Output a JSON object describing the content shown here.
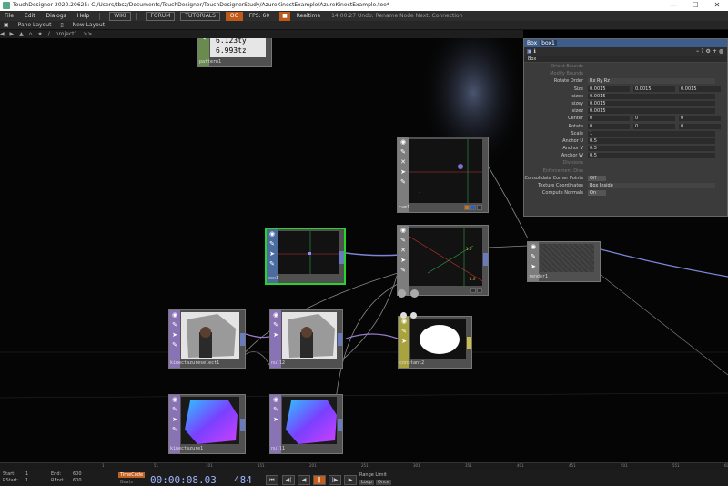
{
  "window": {
    "title": "TouchDesigner 2020.20625: C:/Users/tbsz/Documents/TouchDesigner/TouchDesignerStudy/AzureKinectExample/AzureKinectExample.toe*",
    "minimize": "—",
    "maximize": "☐",
    "close": "✕"
  },
  "menu": {
    "items": [
      "File",
      "Edit",
      "Dialogs",
      "Help"
    ],
    "tags": [
      "WIKI",
      "FORUM",
      "TUTORIALS"
    ],
    "oc": "OC",
    "fps_label": "FPS: 60",
    "realtime": "Realtime",
    "status": "14:00:27 Undo: Rename Node  Next: Connection"
  },
  "layout": {
    "pane_label": "Pane Layout",
    "new_layout": "New Layout"
  },
  "path": {
    "crumbs": [
      "/",
      "project1",
      ">>"
    ]
  },
  "nodes": [
    {
      "id": "pattern1",
      "label": "pattern1",
      "line1": "6.123ty",
      "line2": "6.993tz"
    },
    {
      "id": "cam1",
      "label": "cam1"
    },
    {
      "id": "box1",
      "label": "box1"
    },
    {
      "id": "render1",
      "label": "render1"
    },
    {
      "id": "kinectazureselect1",
      "label": "kinectazureselect1"
    },
    {
      "id": "null2",
      "label": "null2"
    },
    {
      "id": "constant2",
      "label": "constant2"
    },
    {
      "id": "kinectazure1",
      "label": "kinectazure1"
    },
    {
      "id": "null1",
      "label": "null1"
    },
    {
      "id": "geo",
      "label": "",
      "readout1": "1.0",
      "readout2": "1.0"
    }
  ],
  "params": {
    "op_type": "Box",
    "op_name": "box1",
    "tab": "Box",
    "rows": [
      {
        "label": "Orient Bounds",
        "dim": true,
        "value": ""
      },
      {
        "label": "Modify Bounds",
        "dim": true,
        "value": ""
      },
      {
        "label": "Rotate Order",
        "value": "Rx Ry Rz"
      },
      {
        "label": "Size",
        "v": [
          "0.0015",
          "0.0015",
          "0.0015"
        ]
      },
      {
        "label": "sizex",
        "value": "0.0015"
      },
      {
        "label": "sizey",
        "value": "0.0015"
      },
      {
        "label": "sizez",
        "value": "0.0015"
      },
      {
        "label": "Center",
        "v": [
          "0",
          "0",
          "0"
        ]
      },
      {
        "label": "Rotate",
        "v": [
          "0",
          "0",
          "0"
        ]
      },
      {
        "label": "Scale",
        "value": "1"
      },
      {
        "label": "Anchor U",
        "value": "0.5"
      },
      {
        "label": "Anchor V",
        "value": "0.5"
      },
      {
        "label": "Anchor W",
        "value": "0.5"
      },
      {
        "label": "Divisions",
        "dim": true,
        "value": ""
      },
      {
        "label": "Enforcement Divs",
        "dim": true,
        "value": ""
      },
      {
        "label": "Consolidate Corner Points",
        "value": "Off"
      },
      {
        "label": "Texture Coordinates",
        "value": "Box Inside"
      },
      {
        "label": "Compute Normals",
        "value": "On"
      }
    ]
  },
  "timeline": {
    "ticks": [
      "1",
      "51",
      "101",
      "151",
      "201",
      "251",
      "301",
      "351",
      "401",
      "451",
      "501",
      "551",
      "601"
    ],
    "start_label": "Start:",
    "start": "1",
    "rstart_label": "RStart:",
    "rstart": "1",
    "end_label": "End:",
    "end": "600",
    "rend_label": "REnd:",
    "rend": "600",
    "timecode_label": "TimeCode",
    "beats_label": "Beats",
    "timecode": "00:00:08.03",
    "frame": "484",
    "range_label": "Range Limit",
    "range_loop": "Loop",
    "range_once": "Once"
  }
}
